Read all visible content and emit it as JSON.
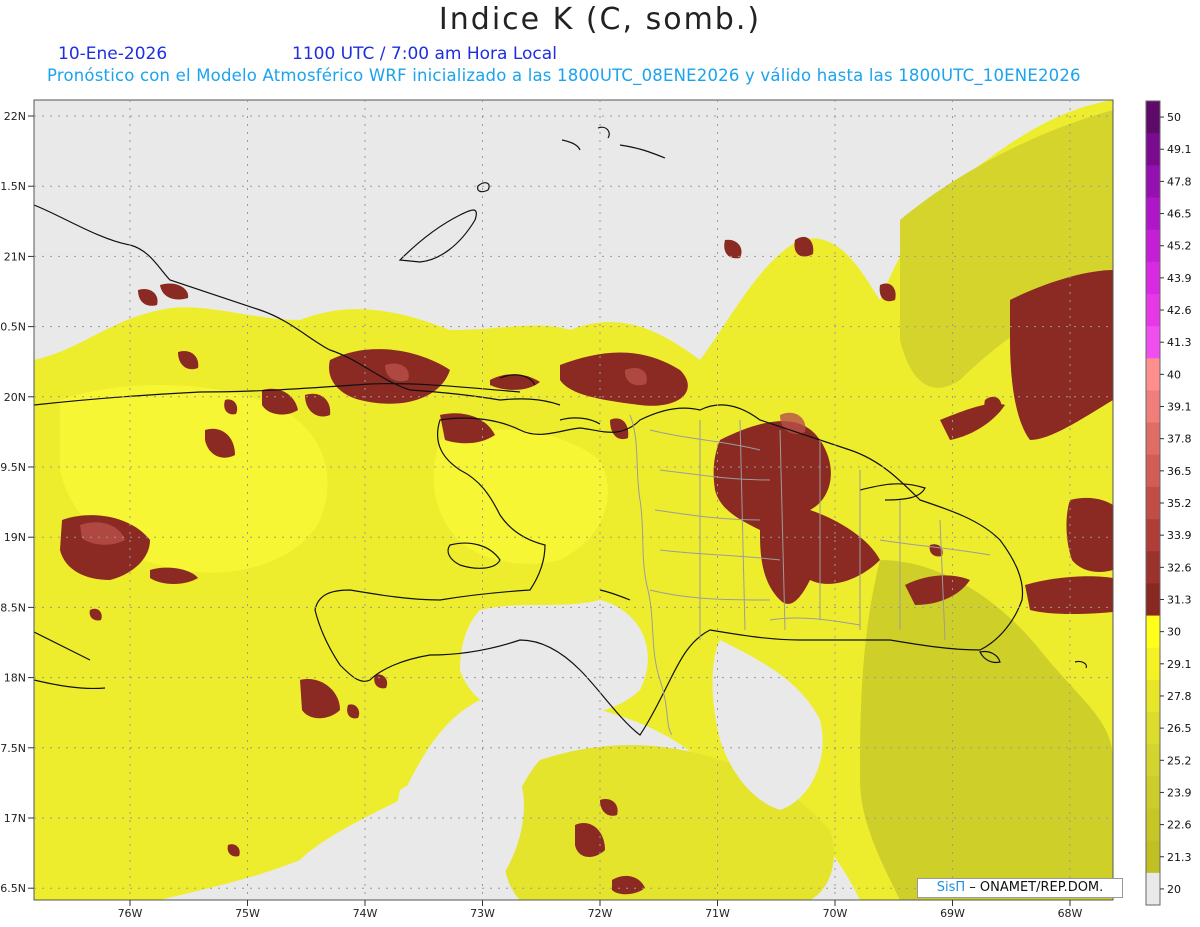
{
  "header": {
    "title": "Indice K (C, somb.)",
    "date": "10-Ene-2026",
    "time": "1100 UTC / 7:00 am Hora Local",
    "subtitle": "Pronóstico con el Modelo Atmosférico WRF inicializado a las 1800UTC_08ENE2026 y válido hasta las  1800UTC_10ENE2026"
  },
  "map": {
    "background_color": "#e9e9e9",
    "lat_labels": [
      "22N",
      "1.5N",
      "21N",
      "0.5N",
      "20N",
      "9.5N",
      "19N",
      "8.5N",
      "18N",
      "7.5N",
      "17N",
      "6.5N"
    ],
    "lon_labels": [
      "76W",
      "75W",
      "74W",
      "73W",
      "72W",
      "71W",
      "70W",
      "69W",
      "68W"
    ]
  },
  "colorbar": {
    "labels": [
      "50",
      "49.1",
      "47.8",
      "46.5",
      "45.2",
      "43.9",
      "42.6",
      "41.3",
      "40",
      "39.1",
      "37.8",
      "36.5",
      "35.2",
      "33.9",
      "32.6",
      "31.3",
      "30",
      "29.1",
      "27.8",
      "26.5",
      "25.2",
      "23.9",
      "22.6",
      "21.3",
      "20"
    ],
    "colors": [
      "#5e0a68",
      "#7a0a8e",
      "#9410b0",
      "#ae16c8",
      "#c41ed6",
      "#d82ae0",
      "#e638e6",
      "#f04ef0",
      "#ff8f8f",
      "#f07e7a",
      "#e06c66",
      "#d25c56",
      "#c24c46",
      "#b03e38",
      "#9c322c",
      "#882820",
      "#ffff1a",
      "#f4f222",
      "#e8e628",
      "#dcdc2c",
      "#d4d42e",
      "#cccc2a",
      "#c6c626",
      "#c0c022",
      "#e9e9e9"
    ]
  },
  "credit": {
    "sis": "SisΠ",
    "text": "– ONAMET/REP.DOM."
  }
}
